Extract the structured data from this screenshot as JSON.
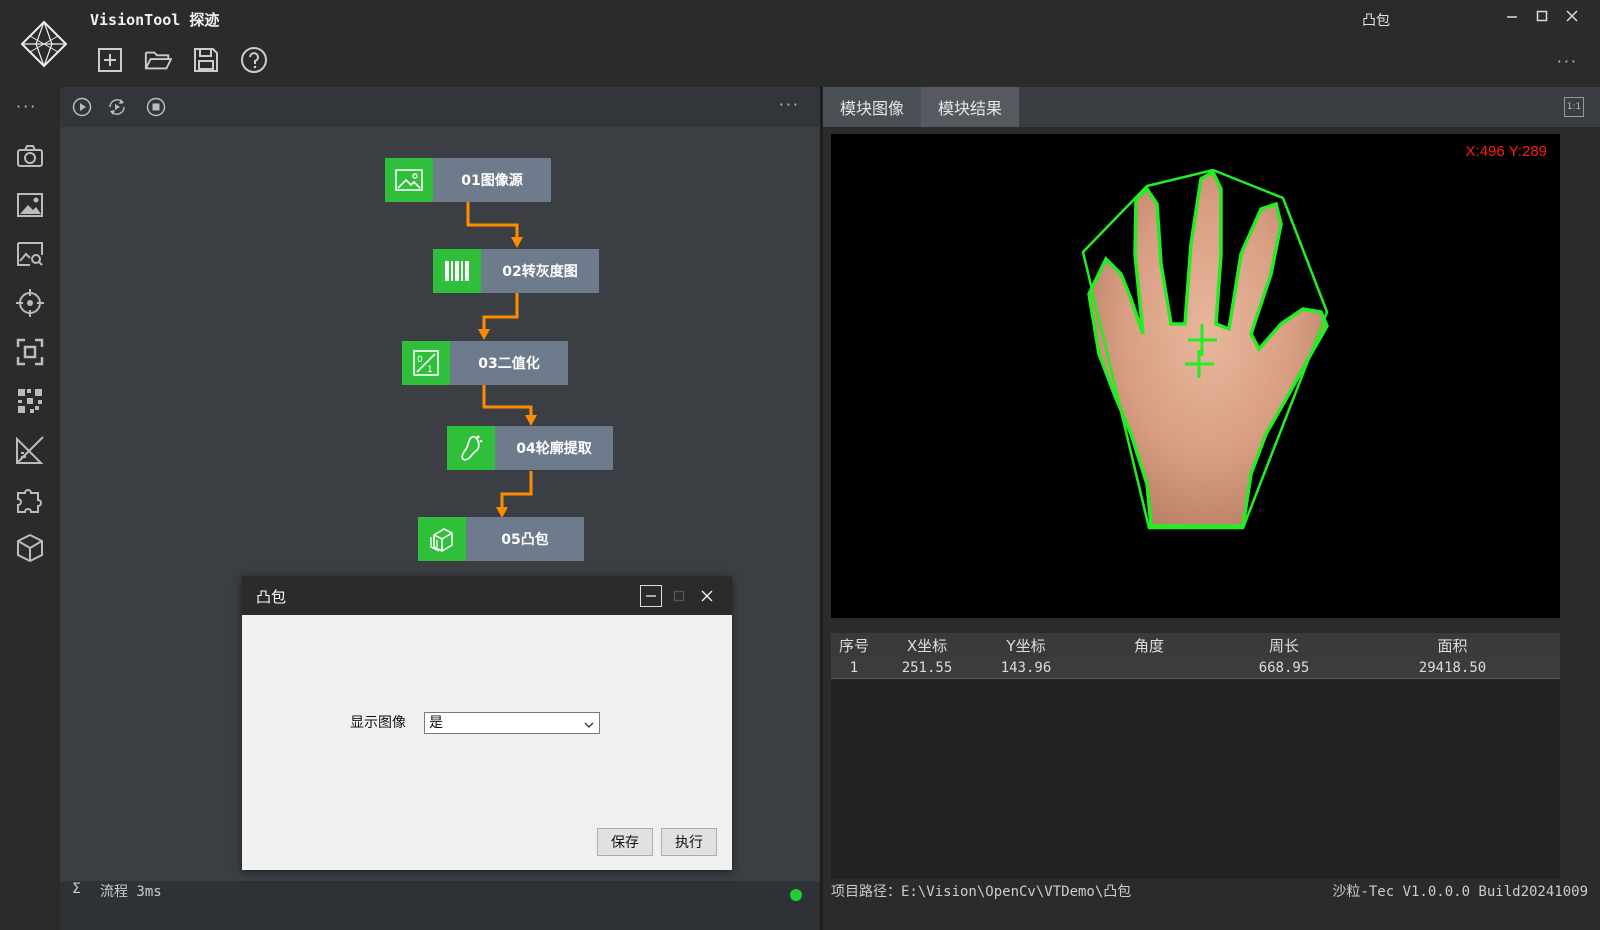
{
  "app": {
    "title": "VisionTool 探迹",
    "window_title": "凸包"
  },
  "toolbar": {
    "icons": [
      "new-file-icon",
      "open-folder-icon",
      "save-icon",
      "help-icon"
    ]
  },
  "leftnav": {
    "icons": [
      "camera-icon",
      "image-icon",
      "image-search-icon",
      "target-icon",
      "focus-icon",
      "grid-icon",
      "ruler-icon",
      "puzzle-icon",
      "cube-icon"
    ]
  },
  "flow": {
    "nodes": [
      {
        "label": "01图像源",
        "icon": "image-icon"
      },
      {
        "label": "02转灰度图",
        "icon": "barcode-icon"
      },
      {
        "label": "03二值化",
        "icon": "binary-icon"
      },
      {
        "label": "04轮廓提取",
        "icon": "foot-icon"
      },
      {
        "label": "05凸包",
        "icon": "cube-icon"
      }
    ],
    "status_sigma": "Σ",
    "status_text": "流程 3ms",
    "status_color": "#22cc33"
  },
  "dialog": {
    "title": "凸包",
    "field_label": "显示图像",
    "field_value": "是",
    "save_label": "保存",
    "run_label": "执行"
  },
  "viewer": {
    "tabs": [
      "模块图像",
      "模块结果"
    ],
    "scale_label": "1:1",
    "coord_text": "X:496 Y:289"
  },
  "results": {
    "headers": [
      "序号",
      "X坐标",
      "Y坐标",
      "角度",
      "周长",
      "面积"
    ],
    "rows": [
      [
        "1",
        "251.55",
        "143.96",
        "",
        "668.95",
        "29418.50"
      ]
    ]
  },
  "footer": {
    "path": "项目路径：E:\\Vision\\OpenCv\\VTDemo\\凸包",
    "version": "沙粒-Tec V1.0.0.0 Build20241009"
  },
  "colors": {
    "accent_green": "#2fbf3a",
    "node_label_bg": "#6e7b8c",
    "connector": "#ff8c00",
    "hull_green": "#22ee22"
  }
}
